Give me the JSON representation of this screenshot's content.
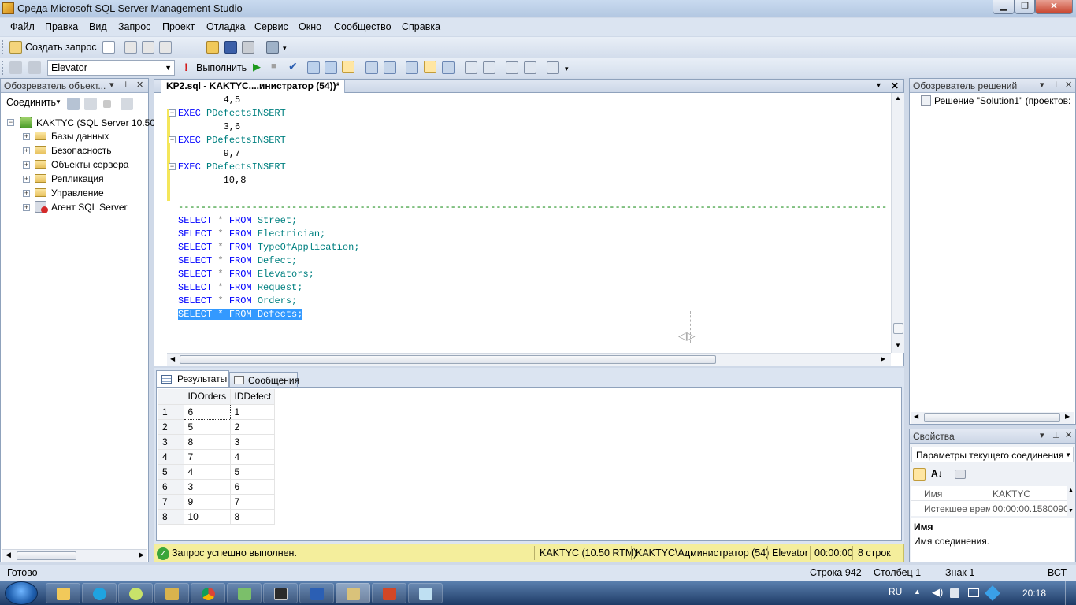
{
  "window": {
    "title": "Среда Microsoft SQL Server Management Studio"
  },
  "menu": [
    "Файл",
    "Правка",
    "Вид",
    "Запрос",
    "Проект",
    "Отладка",
    "Сервис",
    "Окно",
    "Сообщество",
    "Справка"
  ],
  "toolbar1": {
    "new_query": "Создать запрос"
  },
  "toolbar2": {
    "database": "Elevator",
    "execute": "Выполнить"
  },
  "object_explorer": {
    "title": "Обозреватель объект...",
    "connect": "Соединить",
    "server": "KAKTYC (SQL Server 10.50.",
    "nodes": [
      "Базы данных",
      "Безопасность",
      "Объекты сервера",
      "Репликация",
      "Управление",
      "Агент SQL Server"
    ]
  },
  "editor": {
    "tab": "KP2.sql - KAKTYC....инистратор (54))*",
    "code_lines": [
      {
        "a": "        4,5"
      },
      {
        "k": "EXEC",
        "o": "PDefectsINSERT"
      },
      {
        "a": "        3,6"
      },
      {
        "k": "EXEC",
        "o": "PDefectsINSERT"
      },
      {
        "a": "        9,7"
      },
      {
        "k": "EXEC",
        "o": "PDefectsINSERT"
      },
      {
        "a": "        10,8"
      }
    ],
    "dash_line": "------------------------------------------------------------------------------------------------------------------------------------------------------------",
    "selects": [
      {
        "t": "Street;"
      },
      {
        "t": "Electrician;"
      },
      {
        "t": "TypeOfApplication;"
      },
      {
        "t": "Defect;"
      },
      {
        "t": "Elevators;"
      },
      {
        "t": "Request;"
      },
      {
        "t": "Orders;"
      },
      {
        "t": "Defects;"
      }
    ],
    "kw_select": "SELECT",
    "kw_star": "*",
    "kw_from": "FROM"
  },
  "results": {
    "tab_results": "Результаты",
    "tab_messages": "Сообщения",
    "columns": [
      "IDOrders",
      "IDDefect"
    ],
    "rows": [
      [
        "1",
        "6",
        "1"
      ],
      [
        "2",
        "5",
        "2"
      ],
      [
        "3",
        "8",
        "3"
      ],
      [
        "4",
        "7",
        "4"
      ],
      [
        "5",
        "4",
        "5"
      ],
      [
        "6",
        "3",
        "6"
      ],
      [
        "7",
        "9",
        "7"
      ],
      [
        "8",
        "10",
        "8"
      ]
    ]
  },
  "query_status": {
    "message": "Запрос успешно выполнен.",
    "server": "KAKTYC (10.50 RTM)",
    "user": "KAKTYC\\Администратор (54)",
    "db": "Elevator",
    "time": "00:00:00",
    "rows": "8 строк"
  },
  "solution_explorer": {
    "title": "Обозреватель решений",
    "item": "Решение \"Solution1\" (проектов:"
  },
  "properties": {
    "title": "Свойства",
    "selector": "Параметры текущего соединения",
    "rows": [
      {
        "name": "Имя",
        "value": "KAKTYC"
      },
      {
        "name": "Истекшее врем",
        "value": "00:00:00.1580090"
      }
    ],
    "desc_title": "Имя",
    "desc_text": "Имя соединения."
  },
  "statusbar": {
    "ready": "Готово",
    "line": "Строка 942",
    "col": "Столбец 1",
    "char": "Знак 1",
    "mode": "ВСТ"
  },
  "taskbar": {
    "lang": "RU",
    "clock": "20:18"
  }
}
